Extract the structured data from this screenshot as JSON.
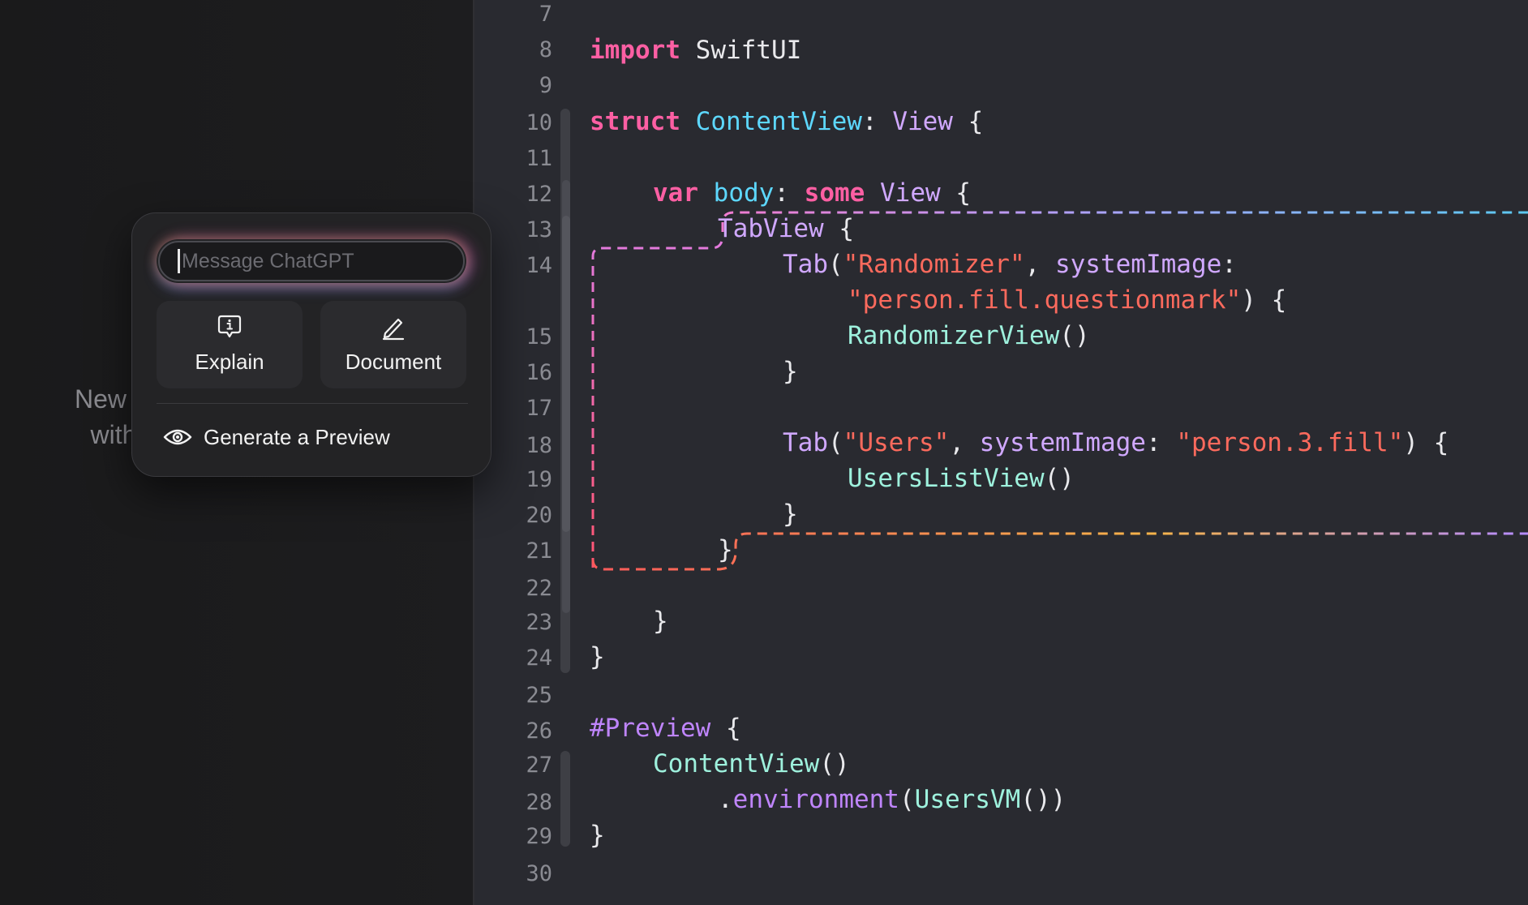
{
  "sidebar": {
    "text_line1": "New C",
    "text_line2": "with"
  },
  "popup": {
    "message_placeholder": "Message ChatGPT",
    "explain_label": "Explain",
    "document_label": "Document",
    "generate_preview_label": "Generate a Preview"
  },
  "editor": {
    "line_numbers": [
      "7",
      "8",
      "9",
      "10",
      "11",
      "12",
      "13",
      "14",
      "15",
      "16",
      "17",
      "18",
      "19",
      "20",
      "21",
      "22",
      "23",
      "24",
      "25",
      "26",
      "27",
      "28",
      "29",
      "30"
    ],
    "code": {
      "l8_kw": "import",
      "l8_mod": "SwiftUI",
      "l10_kw": "struct",
      "l10_name": "ContentView",
      "l10_colon": ":",
      "l10_type": "View",
      "l10_brace": "{",
      "l12_kw": "var",
      "l12_prop": "body",
      "l12_colon": ":",
      "l12_some": "some",
      "l12_type": "View",
      "l12_brace": "{",
      "l13_type": "TabView",
      "l13_brace": "{",
      "l14_tab": "Tab",
      "l14_paren": "(",
      "l14_str": "\"Randomizer\"",
      "l14_comma": ",",
      "l14_param": "systemImage",
      "l14_colon": ":",
      "l14b_str": "\"person.fill.questionmark\"",
      "l14b_rest": ") {",
      "l15_call": "RandomizerView",
      "l15_parens": "()",
      "l16_brace": "}",
      "l18_tab": "Tab",
      "l18_paren": "(",
      "l18_str": "\"Users\"",
      "l18_comma": ",",
      "l18_param": "systemImage",
      "l18_colon": ":",
      "l18_str2": "\"person.3.fill\"",
      "l18_rest": ") {",
      "l19_call": "UsersListView",
      "l19_parens": "()",
      "l20_brace": "}",
      "l21_brace": "}",
      "l23_brace": "}",
      "l24_brace": "}",
      "l26_macro": "#Preview",
      "l26_brace": "{",
      "l27_call": "ContentView",
      "l27_parens": "()",
      "l28_dot": ".",
      "l28_method": "environment",
      "l28_paren": "(",
      "l28_arg": "UsersVM",
      "l28_rest": "())",
      "l29_brace": "}"
    }
  },
  "colors": {
    "keyword": "#fc5fa3",
    "type": "#d0a8ff",
    "type_declaration": "#5dd8ff",
    "string": "#fc6a5d",
    "class_ref": "#9ef1dd",
    "editor_bg": "#292a30",
    "sidebar_bg": "#1c1c1e"
  }
}
